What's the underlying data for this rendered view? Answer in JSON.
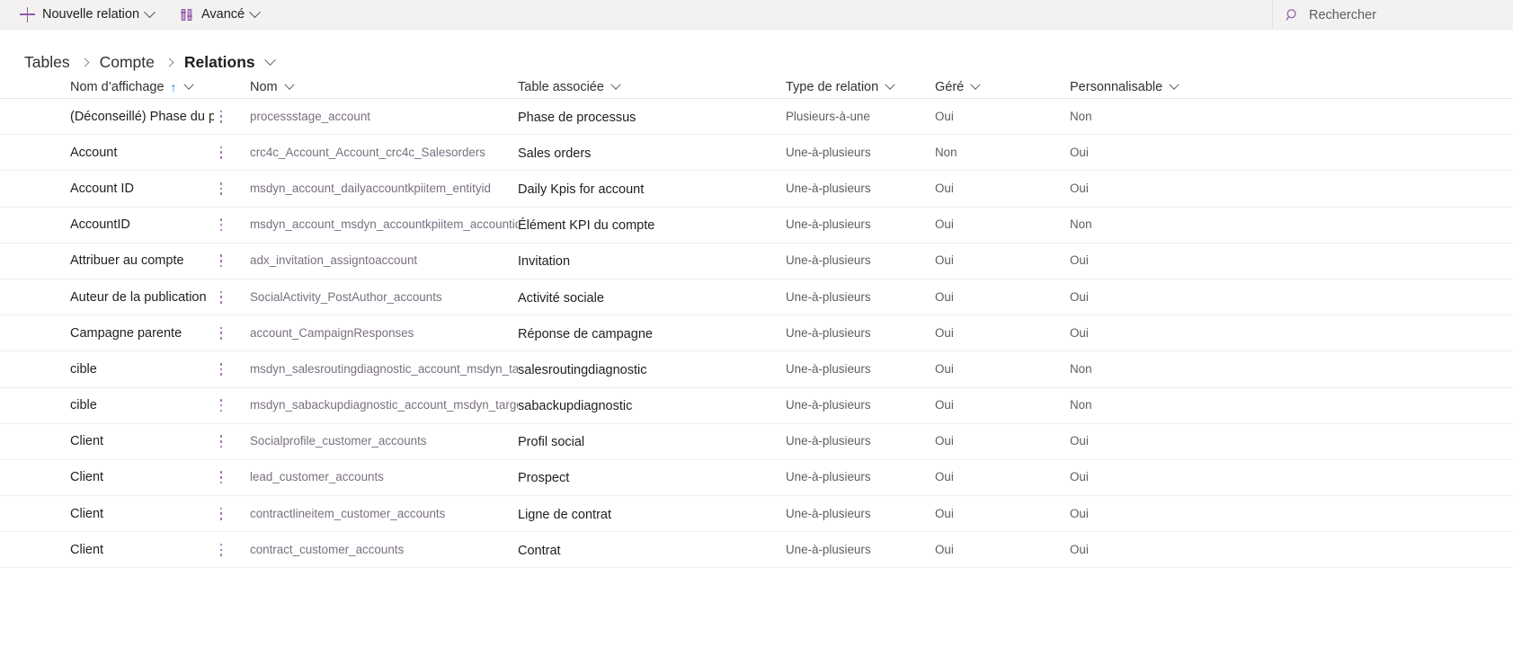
{
  "command_bar": {
    "new_relation": {
      "label": "Nouvelle relation",
      "icon": "plus-icon"
    },
    "advanced": {
      "label": "Avancé",
      "icon": "advanced-filter-icon"
    },
    "search": {
      "label": "Rechercher",
      "icon": "search-icon"
    }
  },
  "breadcrumb": {
    "items": [
      "Tables",
      "Compte",
      "Relations"
    ],
    "current_index": 2
  },
  "grid": {
    "columns": [
      {
        "key": "display_name",
        "label": "Nom d’affichage",
        "sorted": true,
        "sort_direction": "asc",
        "sort_glyph": "↑"
      },
      {
        "key": "name",
        "label": "Nom"
      },
      {
        "key": "related_table",
        "label": "Table associée"
      },
      {
        "key": "relation_type",
        "label": "Type de relation"
      },
      {
        "key": "managed",
        "label": "Géré"
      },
      {
        "key": "customizable",
        "label": "Personnalisable"
      }
    ],
    "rows": [
      {
        "display_name": "(Déconseillé) Phase du processus",
        "name": "processstage_account",
        "related_table": "Phase de processus",
        "relation_type": "Plusieurs-à-une",
        "managed": "Oui",
        "customizable": "Non"
      },
      {
        "display_name": "Account",
        "name": "crc4c_Account_Account_crc4c_Salesorders",
        "related_table": "Sales orders",
        "relation_type": "Une-à-plusieurs",
        "managed": "Non",
        "customizable": "Oui"
      },
      {
        "display_name": "Account ID",
        "name": "msdyn_account_dailyaccountkpiitem_entityid",
        "related_table": "Daily Kpis for account",
        "relation_type": "Une-à-plusieurs",
        "managed": "Oui",
        "customizable": "Oui"
      },
      {
        "display_name": "AccountID",
        "name": "msdyn_account_msdyn_accountkpiitem_accountid",
        "related_table": "Élément KPI du compte",
        "relation_type": "Une-à-plusieurs",
        "managed": "Oui",
        "customizable": "Non"
      },
      {
        "display_name": "Attribuer au compte",
        "name": "adx_invitation_assigntoaccount",
        "related_table": "Invitation",
        "relation_type": "Une-à-plusieurs",
        "managed": "Oui",
        "customizable": "Oui"
      },
      {
        "display_name": "Auteur de la publication",
        "name": "SocialActivity_PostAuthor_accounts",
        "related_table": "Activité sociale",
        "relation_type": "Une-à-plusieurs",
        "managed": "Oui",
        "customizable": "Oui"
      },
      {
        "display_name": "Campagne parente",
        "name": "account_CampaignResponses",
        "related_table": "Réponse de campagne",
        "relation_type": "Une-à-plusieurs",
        "managed": "Oui",
        "customizable": "Oui"
      },
      {
        "display_name": "cible",
        "name": "msdyn_salesroutingdiagnostic_account_msdyn_target",
        "related_table": "salesroutingdiagnostic",
        "relation_type": "Une-à-plusieurs",
        "managed": "Oui",
        "customizable": "Non"
      },
      {
        "display_name": "cible",
        "name": "msdyn_sabackupdiagnostic_account_msdyn_target",
        "related_table": "sabackupdiagnostic",
        "relation_type": "Une-à-plusieurs",
        "managed": "Oui",
        "customizable": "Non"
      },
      {
        "display_name": "Client",
        "name": "Socialprofile_customer_accounts",
        "related_table": "Profil social",
        "relation_type": "Une-à-plusieurs",
        "managed": "Oui",
        "customizable": "Oui"
      },
      {
        "display_name": "Client",
        "name": "lead_customer_accounts",
        "related_table": "Prospect",
        "relation_type": "Une-à-plusieurs",
        "managed": "Oui",
        "customizable": "Oui"
      },
      {
        "display_name": "Client",
        "name": "contractlineitem_customer_accounts",
        "related_table": "Ligne de contrat",
        "relation_type": "Une-à-plusieurs",
        "managed": "Oui",
        "customizable": "Oui"
      },
      {
        "display_name": "Client",
        "name": "contract_customer_accounts",
        "related_table": "Contrat",
        "relation_type": "Une-à-plusieurs",
        "managed": "Oui",
        "customizable": "Oui"
      }
    ],
    "row_menu_icon": "more-vertical-icon"
  },
  "colors": {
    "accent_purple": "#8f5aa8",
    "command_bar_bg": "#f3f2f1",
    "sort_arrow": "#0078d4",
    "row_divider": "#f0eeed"
  }
}
